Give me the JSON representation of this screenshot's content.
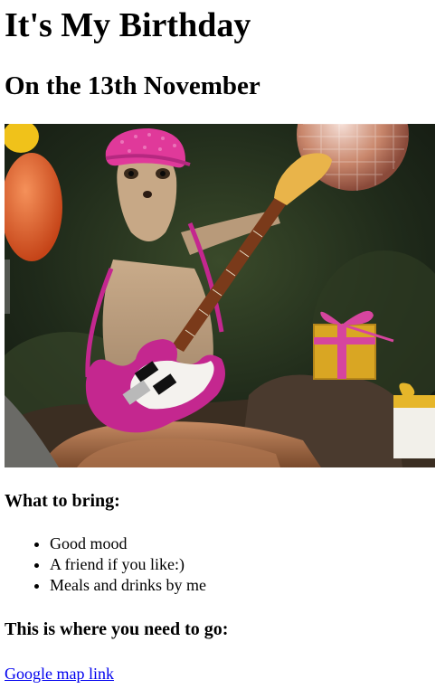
{
  "header": {
    "title": "It's My Birthday",
    "subtitle": "On the 13th November"
  },
  "photo": {
    "icon": "meerkat-guitar-party-photo",
    "colors": {
      "hat": "#e0399a",
      "guitar": "#c4278f",
      "gift": "#d9a623",
      "ribbon": "#d6459e",
      "balloon": "#e2652a"
    }
  },
  "bring": {
    "heading": "What to bring:",
    "items": [
      "Good mood",
      "A friend if you like:)",
      "Meals and drinks by me"
    ]
  },
  "location": {
    "heading": "This is where you need to go:",
    "link_label": "Google map link"
  }
}
